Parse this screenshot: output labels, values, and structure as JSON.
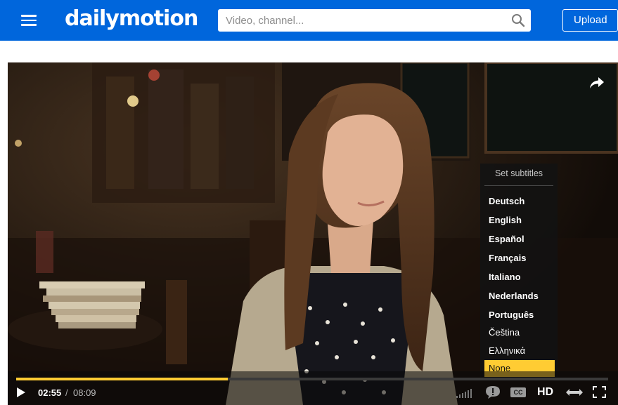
{
  "header": {
    "menu_icon": "hamburger-menu-icon",
    "logo_text": "dailymotion",
    "search_placeholder": "Video, channel...",
    "search_icon": "search-icon",
    "upload_label": "Upload",
    "bar_color": "#0066dc"
  },
  "player": {
    "share_icon": "share-arrow-icon",
    "subtitles_menu": {
      "title": "Set subtitles",
      "items": [
        {
          "label": "Deutsch",
          "bold": true
        },
        {
          "label": "English",
          "bold": true
        },
        {
          "label": "Español",
          "bold": true
        },
        {
          "label": "Français",
          "bold": true
        },
        {
          "label": "Italiano",
          "bold": true
        },
        {
          "label": "Nederlands",
          "bold": true
        },
        {
          "label": "Português",
          "bold": true
        },
        {
          "label": "Čeština",
          "bold": false
        },
        {
          "label": "Ελληνικά",
          "bold": false
        },
        {
          "label": "None",
          "bold": false,
          "selected": true
        }
      ],
      "selected_color": "#ffcc33"
    },
    "controls": {
      "play_icon": "play-icon",
      "current_time": "02:55",
      "separator": "/",
      "total_time": "08:09",
      "progress_fraction": 0.358,
      "progress_color": "#ffcc33",
      "quality_icon": "signal-bars-icon",
      "comment_icon": "speech-bubble-icon",
      "cc_label": "CC",
      "hd_label": "HD",
      "widescreen_icon": "widescreen-arrows-icon",
      "fullscreen_icon": "fullscreen-icon"
    }
  }
}
